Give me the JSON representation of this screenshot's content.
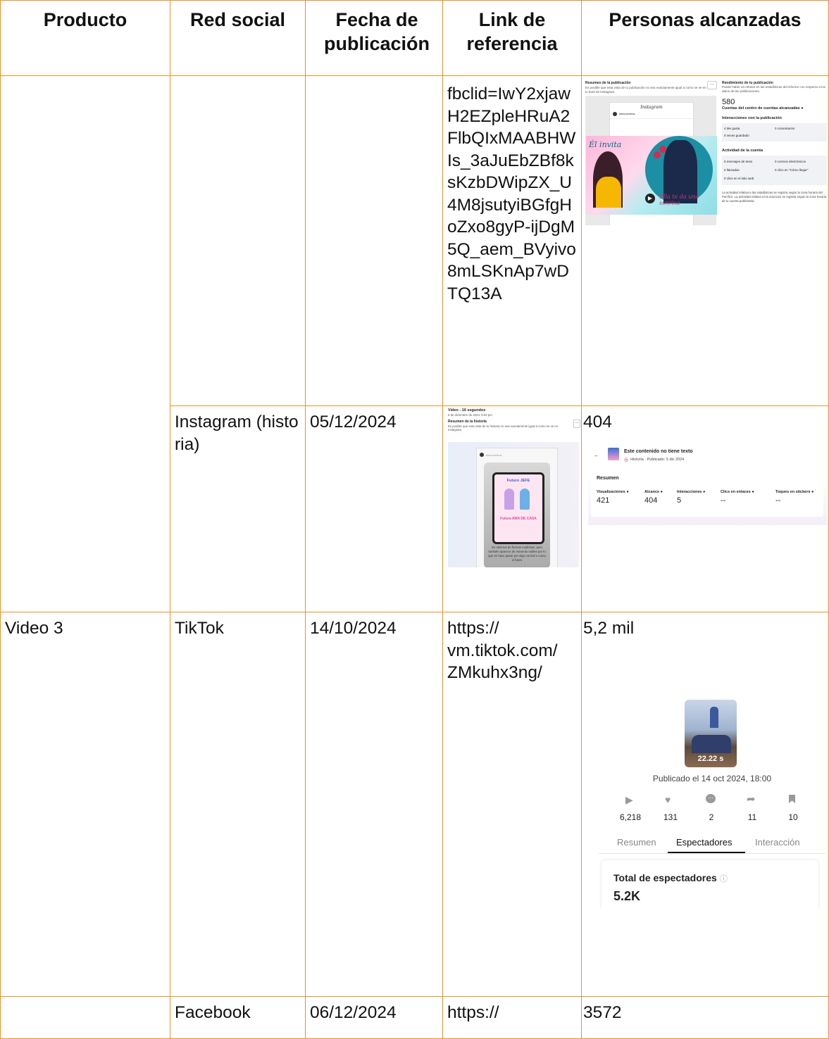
{
  "headers": {
    "producto": "Producto",
    "red_social": "Red social",
    "fecha": "Fecha de publicación",
    "link": "Link de referencia",
    "personas": "Personas alcanzadas"
  },
  "rows": [
    {
      "producto": "",
      "red_social": "",
      "fecha": "",
      "link": "fbclid=IwY2xjawH2EZpleHRuA2FlbQIxMAABHWIs_3aJuEbZBf8ksKzbDWipZX_U4M8jsutyiBGfgHoZxo8gyP-ijDgM5Q_aem_BVyivo8mLSKnAp7wDTQ13A",
      "personas": ""
    },
    {
      "producto": "",
      "red_social": "Instagram (historia)",
      "fecha": "05/12/2024",
      "link": "",
      "personas": "404"
    },
    {
      "producto": "Video 3",
      "red_social": "TikTok",
      "fecha": "14/10/2024",
      "link": "https:// vm.tiktok.com/ ZMkuhx3ng/",
      "personas": "5,2 mil"
    },
    {
      "producto": "",
      "red_social": "Facebook",
      "fecha": "06/12/2024",
      "link": "https://",
      "personas": "3572"
    }
  ],
  "ig_post_shot": {
    "resumen_title": "Resumen de la publicación",
    "resumen_sub": "Es posible que esta vista de tu publicación no sea exactamente igual a como se ve en tu feed de Instagram.",
    "brand": "Instagram",
    "account": "letsvoceteca",
    "poster_left": "Él invita",
    "poster_right": "Ella te da una sonrisa",
    "rend_title": "Rendimiento de tu publicación",
    "rend_sub": "Puede haber un retraso en las estadísticas del informe con respecto a los datos de las publicaciones.",
    "reach": "580",
    "reach_label": "Cuentas del centro de cuentas alcanzadas",
    "inter_title": "Interacciones con la publicación",
    "likes": "4 Me gusta",
    "comments": "0 comentarios",
    "saves": "0 veces guardado",
    "activity_title": "Actividad de la cuenta",
    "msgs": "0 mensajes de texto",
    "emails": "0 correos electrónicos",
    "calls": "0 llamadas",
    "directions": "0 clics en \"Cómo llegar\"",
    "web": "0 clics en el sitio web",
    "footnote": "La actividad relativa a las estadísticas se registra según la zona horaria del Pacífico. La actividad relativa a los anuncios se registra según la zona horaria de tu cuenta publicitaria."
  },
  "ig_story_shot": {
    "title": "Video - 16 segundos",
    "date": "5 de diciembre de 2024, 6:04 pm",
    "resumen_title": "Resumen de la historia",
    "resumen_sub": "Es posible que esta vista de tu historia no sea exactamente igual a como se ve en Instagram.",
    "account": "letsvoceteca",
    "card_top": "Futuro JEFE",
    "card_bottom": "Futura AMA DE CASA",
    "caption": "Se observa de formas explícitas, pero también aparece de maneras sutiles por lo que se hace pasar por algo normal o como si fuera"
  },
  "ig_story_stats": {
    "headline": "Este contenido no tiene texto",
    "meta": "Historia · Publicado: 5 dic 2024",
    "resumen": "Resumen",
    "labels": [
      "Visualizaciones",
      "Alcance",
      "Interacciones",
      "Clics en enlaces",
      "Toques en stickers"
    ],
    "values": [
      "421",
      "404",
      "5",
      "--",
      "--"
    ]
  },
  "tiktok_shot": {
    "duration": "22.22 s",
    "published": "Publicado el 14 oct 2024, 18:00",
    "stats": [
      "6,218",
      "131",
      "2",
      "11",
      "10"
    ],
    "tabs": [
      "Resumen",
      "Espectadores",
      "Interacción"
    ],
    "total_label": "Total de espectadores",
    "total_value": "5.2K"
  }
}
